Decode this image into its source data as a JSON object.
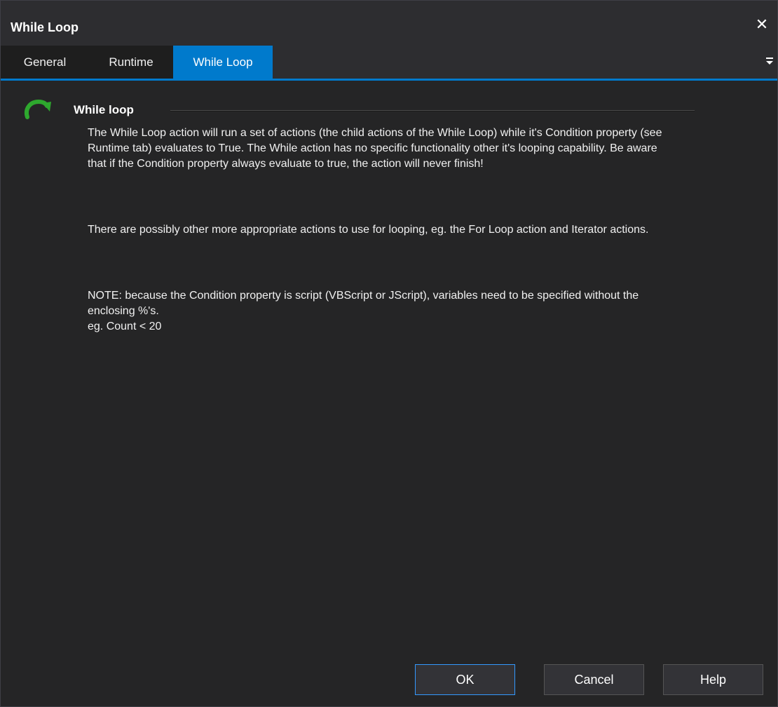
{
  "window": {
    "title": "While Loop",
    "close_glyph": "✕"
  },
  "tabs": [
    {
      "label": "General",
      "active": false
    },
    {
      "label": "Runtime",
      "active": false
    },
    {
      "label": "While Loop",
      "active": true
    }
  ],
  "content": {
    "icon": "loop-arrow-icon",
    "section_title": "While loop",
    "paragraphs": [
      "The While Loop action will run a set of actions (the child actions of the While Loop) while it's Condition property (see Runtime tab) evaluates to True.  The While action has no specific functionality other it's looping capability.  Be aware that if the Condition property always evaluate to true, the action will never finish!",
      "There are possibly other more appropriate actions to use for looping, eg. the For Loop action and Iterator actions.",
      "NOTE: because the Condition property is script (VBScript or JScript), variables need to be specified without the enclosing %'s.\neg. Count < 20"
    ]
  },
  "buttons": {
    "ok": "OK",
    "cancel": "Cancel",
    "help": "Help"
  },
  "colors": {
    "accent": "#007acc",
    "background": "#252526",
    "titlebar": "#2d2d30",
    "icon_green": "#2ea82e"
  }
}
